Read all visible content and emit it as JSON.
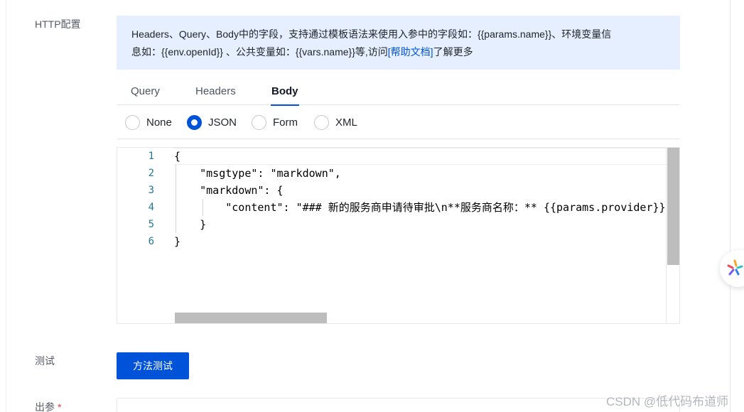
{
  "form": {
    "http_label": "HTTP配置",
    "test_label": "测试",
    "output_label": "出参",
    "required_mark": "*"
  },
  "info": {
    "line1": "Headers、Query、Body中的字段，支持通过模板语法来使用入参中的字段如：{{params.name}}、环境变量信",
    "line2_prefix": "息如：{{env.openId}} 、公共变量如：{{vars.name}}等,访问",
    "link": "[帮助文档]",
    "line2_suffix": "了解更多"
  },
  "tabs": [
    {
      "label": "Query",
      "active": false
    },
    {
      "label": "Headers",
      "active": false
    },
    {
      "label": "Body",
      "active": true
    }
  ],
  "body_type": {
    "options": [
      "None",
      "JSON",
      "Form",
      "XML"
    ],
    "selected": "JSON"
  },
  "editor": {
    "line_numbers": [
      "1",
      "2",
      "3",
      "4",
      "5",
      "6"
    ],
    "lines": [
      "{",
      "    \"msgtype\": \"markdown\",",
      "    \"markdown\": {",
      "        \"content\": \"### 新的服务商申请待审批\\n**服务商名称：** {{params.provider}}\"",
      "    }",
      "}"
    ]
  },
  "test_button": {
    "label": "方法测试"
  },
  "watermark": "CSDN @低代码布道师",
  "colors": {
    "primary": "#0052d9",
    "info_bg": "#e6efff",
    "line_number": "#237893"
  },
  "icons": {
    "assistant": "assistant-logo-icon"
  }
}
